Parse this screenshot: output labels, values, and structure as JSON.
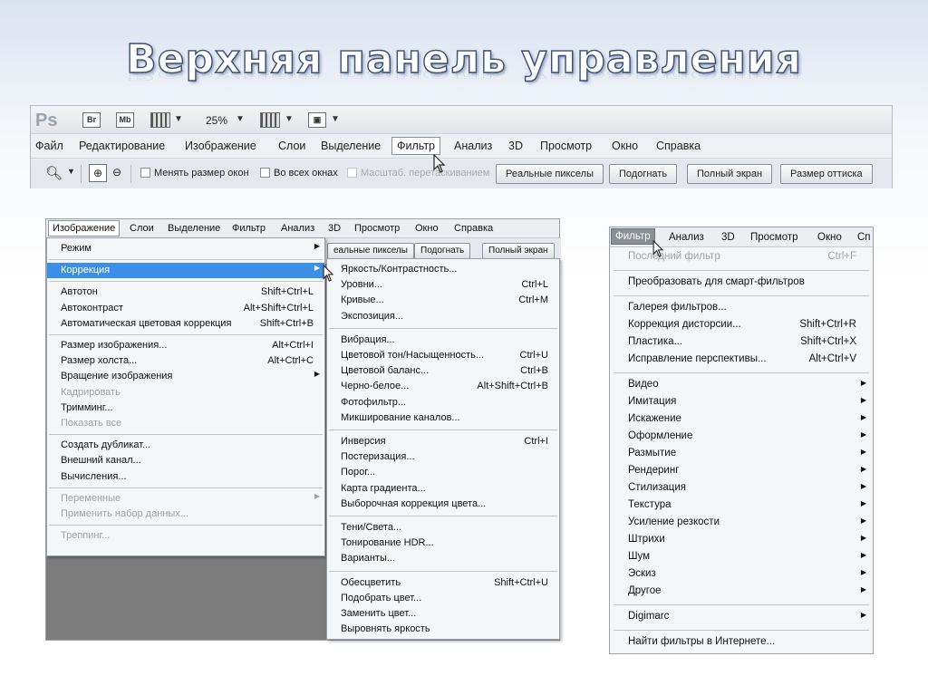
{
  "slide": {
    "title": "Верхняя панель управления"
  },
  "ps_panel": {
    "app_logo": "Ps",
    "br_label": "Br",
    "mb_label": "Mb",
    "zoom": "25%",
    "menu": [
      "Файл",
      "Редактирование",
      "Изображение",
      "Слои",
      "Выделение",
      "Фильтр",
      "Анализ",
      "3D",
      "Просмотр",
      "Окно",
      "Справка"
    ],
    "options": {
      "resize_windows": "Менять размер окон",
      "all_windows": "Во всех окнах",
      "scrubby_zoom": "Масштаб. перетаскиванием",
      "actual_pixels": "Реальные пикселы",
      "fit_screen": "Подогнать",
      "full_screen": "Полный экран",
      "print_size": "Размер оттиска"
    }
  },
  "image_menu_shot": {
    "menubar": [
      "Изображение",
      "Слои",
      "Выделение",
      "Фильтр",
      "Анализ",
      "3D",
      "Просмотр",
      "Окно",
      "Справка"
    ],
    "strip_buttons": [
      "еальные пикселы",
      "Подогнать",
      "Полный экран"
    ],
    "image_menu": [
      {
        "label": "Режим",
        "shortcut": "",
        "submenu": true,
        "disabled": false
      },
      {
        "sep": true
      },
      {
        "label": "Коррекция",
        "shortcut": "",
        "submenu": true,
        "disabled": false,
        "highlight": true
      },
      {
        "sep": true
      },
      {
        "label": "Автотон",
        "shortcut": "Shift+Ctrl+L"
      },
      {
        "label": "Автоконтраст",
        "shortcut": "Alt+Shift+Ctrl+L"
      },
      {
        "label": "Автоматическая цветовая коррекция",
        "shortcut": "Shift+Ctrl+B"
      },
      {
        "sep": true
      },
      {
        "label": "Размер изображения...",
        "shortcut": "Alt+Ctrl+I"
      },
      {
        "label": "Размер холста...",
        "shortcut": "Alt+Ctrl+C"
      },
      {
        "label": "Вращение изображения",
        "shortcut": "",
        "submenu": true
      },
      {
        "label": "Кадрировать",
        "shortcut": "",
        "disabled": true
      },
      {
        "label": "Тримминг...",
        "shortcut": ""
      },
      {
        "label": "Показать все",
        "shortcut": "",
        "disabled": true
      },
      {
        "sep": true
      },
      {
        "label": "Создать дубликат...",
        "shortcut": ""
      },
      {
        "label": "Внешний канал...",
        "shortcut": ""
      },
      {
        "label": "Вычисления...",
        "shortcut": ""
      },
      {
        "sep": true
      },
      {
        "label": "Переменные",
        "shortcut": "",
        "submenu": true,
        "disabled": true
      },
      {
        "label": "Применить набор данных...",
        "shortcut": "",
        "disabled": true
      },
      {
        "sep": true
      },
      {
        "label": "Треппинг...",
        "shortcut": "",
        "disabled": true
      }
    ],
    "correction_menu": [
      {
        "label": "Яркость/Контрастность...",
        "shortcut": ""
      },
      {
        "label": "Уровни...",
        "shortcut": "Ctrl+L"
      },
      {
        "label": "Кривые...",
        "shortcut": "Ctrl+M"
      },
      {
        "label": "Экспозиция...",
        "shortcut": ""
      },
      {
        "sep": true
      },
      {
        "label": "Вибрация...",
        "shortcut": ""
      },
      {
        "label": "Цветовой тон/Насыщенность...",
        "shortcut": "Ctrl+U"
      },
      {
        "label": "Цветовой баланс...",
        "shortcut": "Ctrl+B"
      },
      {
        "label": "Черно-белое...",
        "shortcut": "Alt+Shift+Ctrl+B"
      },
      {
        "label": "Фотофильтр...",
        "shortcut": ""
      },
      {
        "label": "Микширование каналов...",
        "shortcut": ""
      },
      {
        "sep": true
      },
      {
        "label": "Инверсия",
        "shortcut": "Ctrl+I"
      },
      {
        "label": "Постеризация...",
        "shortcut": ""
      },
      {
        "label": "Порог...",
        "shortcut": ""
      },
      {
        "label": "Карта градиента...",
        "shortcut": ""
      },
      {
        "label": "Выборочная коррекция цвета...",
        "shortcut": ""
      },
      {
        "sep": true
      },
      {
        "label": "Тени/Света...",
        "shortcut": ""
      },
      {
        "label": "Тонирование HDR...",
        "shortcut": ""
      },
      {
        "label": "Варианты...",
        "shortcut": ""
      },
      {
        "sep": true
      },
      {
        "label": "Обесцветить",
        "shortcut": "Shift+Ctrl+U"
      },
      {
        "label": "Подобрать цвет...",
        "shortcut": ""
      },
      {
        "label": "Заменить цвет...",
        "shortcut": ""
      },
      {
        "label": "Выровнять яркость",
        "shortcut": ""
      }
    ]
  },
  "filter_shot": {
    "menubar": [
      "Фильтр",
      "Анализ",
      "3D",
      "Просмотр",
      "Окно",
      "Сп"
    ],
    "items": [
      {
        "label": "Последний фильтр",
        "shortcut": "Ctrl+F",
        "disabled": true
      },
      {
        "sep": true
      },
      {
        "label": "Преобразовать для смарт-фильтров",
        "shortcut": ""
      },
      {
        "sep": true
      },
      {
        "label": "Галерея фильтров...",
        "shortcut": ""
      },
      {
        "label": "Коррекция дисторсии...",
        "shortcut": "Shift+Ctrl+R"
      },
      {
        "label": "Пластика...",
        "shortcut": "Shift+Ctrl+X"
      },
      {
        "label": "Исправление перспективы...",
        "shortcut": "Alt+Ctrl+V"
      },
      {
        "sep": true
      },
      {
        "label": "Видео",
        "submenu": true
      },
      {
        "label": "Имитация",
        "submenu": true
      },
      {
        "label": "Искажение",
        "submenu": true
      },
      {
        "label": "Оформление",
        "submenu": true
      },
      {
        "label": "Размытие",
        "submenu": true
      },
      {
        "label": "Рендеринг",
        "submenu": true
      },
      {
        "label": "Стилизация",
        "submenu": true
      },
      {
        "label": "Текстура",
        "submenu": true
      },
      {
        "label": "Усиление резкости",
        "submenu": true
      },
      {
        "label": "Штрихи",
        "submenu": true
      },
      {
        "label": "Шум",
        "submenu": true
      },
      {
        "label": "Эскиз",
        "submenu": true
      },
      {
        "label": "Другое",
        "submenu": true
      },
      {
        "sep": true
      },
      {
        "label": "Digimarc",
        "submenu": true
      },
      {
        "sep": true
      },
      {
        "label": "Найти фильтры в Интернете...",
        "shortcut": ""
      }
    ]
  }
}
